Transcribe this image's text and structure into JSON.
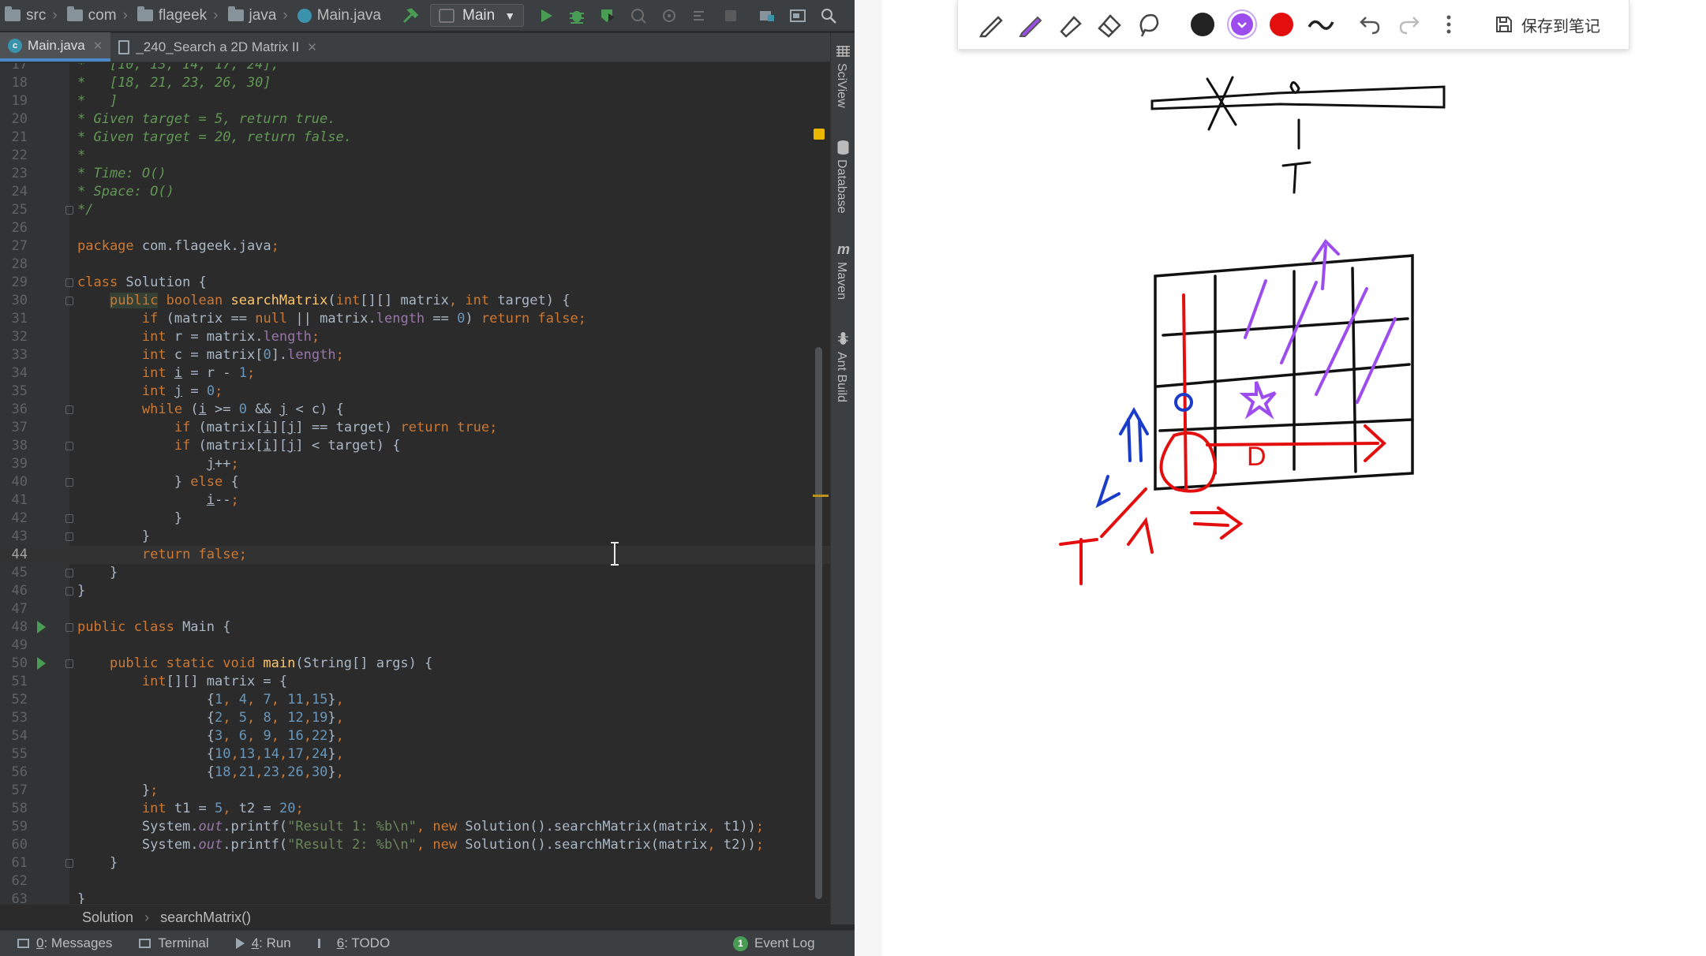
{
  "toolbar": {
    "breadcrumbs": [
      "src",
      "com",
      "flageek",
      "java",
      "Main.java"
    ],
    "run_config": "Main"
  },
  "tabs": [
    {
      "label": "Main.java",
      "active": true
    },
    {
      "label": "_240_Search a 2D Matrix II",
      "active": false
    }
  ],
  "right_tools": [
    "SciView",
    "Database",
    "Maven",
    "Ant Build"
  ],
  "editor": {
    "first_line_number": 17,
    "current_line": 44
  },
  "breadcrumb": [
    "Solution",
    "searchMatrix()"
  ],
  "status_bar": {
    "messages": {
      "num": "0",
      "label": ": Messages"
    },
    "terminal": "Terminal",
    "run": {
      "num": "4",
      "label": ": Run"
    },
    "todo": {
      "num": "6",
      "label": ": TODO"
    },
    "event_log_count": "1",
    "event_log": "Event Log"
  },
  "note_toolbar": {
    "save_label": "保存到笔记",
    "colors": {
      "black": "#222222",
      "purple": "#9d4ced",
      "red": "#e30f0f"
    }
  },
  "drawing_text": {
    "top_mark": "T",
    "bottom_mark": "T",
    "d_mark": "D"
  }
}
